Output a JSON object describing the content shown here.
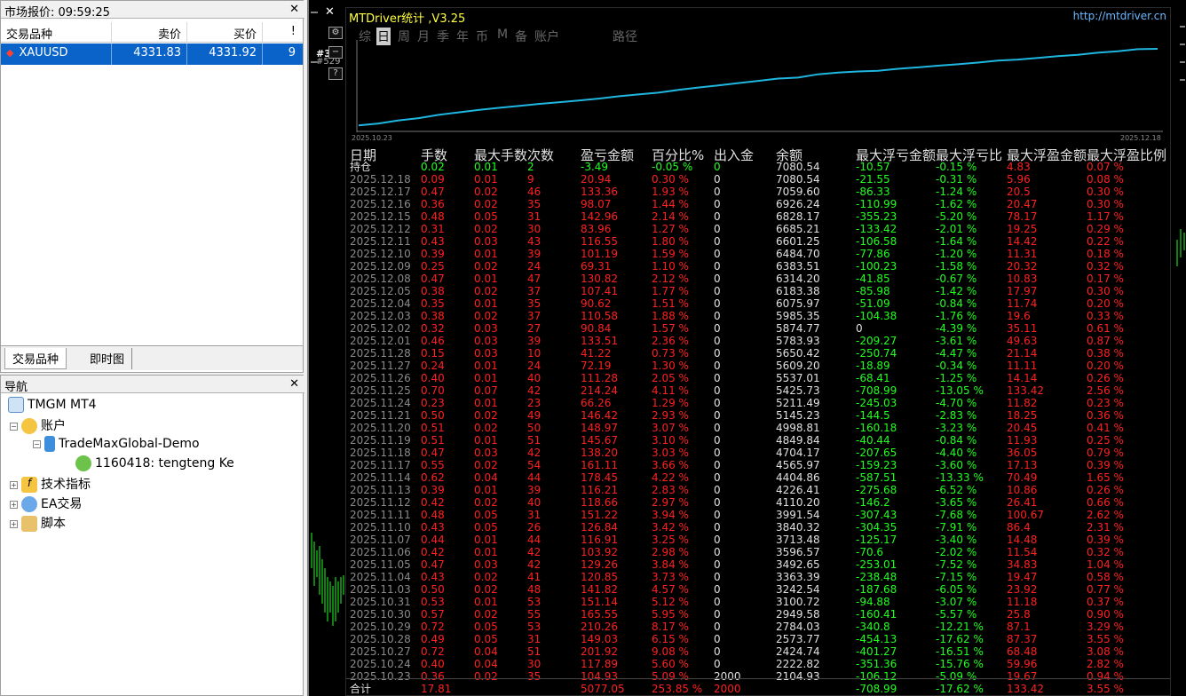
{
  "market_watch": {
    "title": "市场报价: 09:59:25",
    "columns": [
      "交易品种",
      "卖价",
      "买价",
      "!"
    ],
    "row": {
      "symbol": "XAUUSD",
      "bid": "4331.83",
      "ask": "4331.92",
      "spread": "9"
    },
    "tabs": [
      "交易品种",
      "即时图"
    ]
  },
  "navigator": {
    "title": "导航",
    "items": {
      "root": "TMGM MT4",
      "accounts": "账户",
      "account_server": "TradeMaxGlobal-Demo",
      "account_user": "1160418: tengteng Ke",
      "indicators": "技术指标",
      "experts": "EA交易",
      "scripts": "脚本"
    }
  },
  "chart": {
    "label_left": "#3",
    "label_left2": "#529"
  },
  "mtdriver": {
    "title": "MTDriver统计 ,V3.25",
    "url": "http://mtdriver.cn",
    "menu": [
      "综",
      "日",
      "周",
      "月",
      "季",
      "年",
      "币",
      "M",
      "备",
      "账户",
      "路径"
    ],
    "date_start": "2025.10.23",
    "date_end": "2025.12.18",
    "columns": [
      "日期",
      "手数",
      "最大手数",
      "次数",
      "盈亏金额",
      "百分比%",
      "出入金",
      "余额",
      "最大浮亏金额",
      "最大浮亏比",
      "最大浮盈金额",
      "最大浮盈比例"
    ],
    "rows": [
      [
        "持仓",
        "0.02",
        "0.01",
        "2",
        "-3.49",
        "-0.05 %",
        "0",
        "7080.54",
        "-10.57",
        "-0.15 %",
        "4.83",
        "0.07 %"
      ],
      [
        "2025.12.18",
        "0.09",
        "0.01",
        "9",
        "20.94",
        "0.30 %",
        "0",
        "7080.54",
        "-21.55",
        "-0.31 %",
        "5.96",
        "0.08 %"
      ],
      [
        "2025.12.17",
        "0.47",
        "0.02",
        "46",
        "133.36",
        "1.93 %",
        "0",
        "7059.60",
        "-86.33",
        "-1.24 %",
        "20.5",
        "0.30 %"
      ],
      [
        "2025.12.16",
        "0.36",
        "0.02",
        "35",
        "98.07",
        "1.44 %",
        "0",
        "6926.24",
        "-110.99",
        "-1.62 %",
        "20.47",
        "0.30 %"
      ],
      [
        "2025.12.15",
        "0.48",
        "0.05",
        "31",
        "142.96",
        "2.14 %",
        "0",
        "6828.17",
        "-355.23",
        "-5.20 %",
        "78.17",
        "1.17 %"
      ],
      [
        "2025.12.12",
        "0.31",
        "0.02",
        "30",
        "83.96",
        "1.27 %",
        "0",
        "6685.21",
        "-133.42",
        "-2.01 %",
        "19.25",
        "0.29 %"
      ],
      [
        "2025.12.11",
        "0.43",
        "0.03",
        "43",
        "116.55",
        "1.80 %",
        "0",
        "6601.25",
        "-106.58",
        "-1.64 %",
        "14.42",
        "0.22 %"
      ],
      [
        "2025.12.10",
        "0.39",
        "0.01",
        "39",
        "101.19",
        "1.59 %",
        "0",
        "6484.70",
        "-77.86",
        "-1.20 %",
        "11.31",
        "0.18 %"
      ],
      [
        "2025.12.09",
        "0.25",
        "0.02",
        "24",
        "69.31",
        "1.10 %",
        "0",
        "6383.51",
        "-100.23",
        "-1.58 %",
        "20.32",
        "0.32 %"
      ],
      [
        "2025.12.08",
        "0.47",
        "0.01",
        "47",
        "130.82",
        "2.12 %",
        "0",
        "6314.20",
        "-41.85",
        "-0.67 %",
        "10.83",
        "0.17 %"
      ],
      [
        "2025.12.05",
        "0.38",
        "0.02",
        "37",
        "107.41",
        "1.77 %",
        "0",
        "6183.38",
        "-85.98",
        "-1.42 %",
        "17.97",
        "0.30 %"
      ],
      [
        "2025.12.04",
        "0.35",
        "0.01",
        "35",
        "90.62",
        "1.51 %",
        "0",
        "6075.97",
        "-51.09",
        "-0.84 %",
        "11.74",
        "0.20 %"
      ],
      [
        "2025.12.03",
        "0.38",
        "0.02",
        "37",
        "110.58",
        "1.88 %",
        "0",
        "5985.35",
        "-104.38",
        "-1.76 %",
        "19.6",
        "0.33 %"
      ],
      [
        "2025.12.02",
        "0.32",
        "0.03",
        "27",
        "90.84",
        "1.57 %",
        "0",
        "5874.77",
        "0",
        "-4.39 %",
        "35.11",
        "0.61 %"
      ],
      [
        "2025.12.01",
        "0.46",
        "0.03",
        "39",
        "133.51",
        "2.36 %",
        "0",
        "5783.93",
        "-209.27",
        "-3.61 %",
        "49.63",
        "0.87 %"
      ],
      [
        "2025.11.28",
        "0.15",
        "0.03",
        "10",
        "41.22",
        "0.73 %",
        "0",
        "5650.42",
        "-250.74",
        "-4.47 %",
        "21.14",
        "0.38 %"
      ],
      [
        "2025.11.27",
        "0.24",
        "0.01",
        "24",
        "72.19",
        "1.30 %",
        "0",
        "5609.20",
        "-18.89",
        "-0.34 %",
        "11.11",
        "0.20 %"
      ],
      [
        "2025.11.26",
        "0.40",
        "0.01",
        "40",
        "111.28",
        "2.05 %",
        "0",
        "5537.01",
        "-68.41",
        "-1.25 %",
        "14.14",
        "0.26 %"
      ],
      [
        "2025.11.25",
        "0.70",
        "0.07",
        "42",
        "214.24",
        "4.11 %",
        "0",
        "5425.73",
        "-708.99",
        "-13.05 %",
        "133.42",
        "2.56 %"
      ],
      [
        "2025.11.24",
        "0.23",
        "0.01",
        "23",
        "66.26",
        "1.29 %",
        "0",
        "5211.49",
        "-245.03",
        "-4.70 %",
        "11.82",
        "0.23 %"
      ],
      [
        "2025.11.21",
        "0.50",
        "0.02",
        "49",
        "146.42",
        "2.93 %",
        "0",
        "5145.23",
        "-144.5",
        "-2.83 %",
        "18.25",
        "0.36 %"
      ],
      [
        "2025.11.20",
        "0.51",
        "0.02",
        "50",
        "148.97",
        "3.07 %",
        "0",
        "4998.81",
        "-160.18",
        "-3.23 %",
        "20.45",
        "0.41 %"
      ],
      [
        "2025.11.19",
        "0.51",
        "0.01",
        "51",
        "145.67",
        "3.10 %",
        "0",
        "4849.84",
        "-40.44",
        "-0.84 %",
        "11.93",
        "0.25 %"
      ],
      [
        "2025.11.18",
        "0.47",
        "0.03",
        "42",
        "138.20",
        "3.03 %",
        "0",
        "4704.17",
        "-207.65",
        "-4.40 %",
        "36.05",
        "0.79 %"
      ],
      [
        "2025.11.17",
        "0.55",
        "0.02",
        "54",
        "161.11",
        "3.66 %",
        "0",
        "4565.97",
        "-159.23",
        "-3.60 %",
        "17.13",
        "0.39 %"
      ],
      [
        "2025.11.14",
        "0.62",
        "0.04",
        "44",
        "178.45",
        "4.22 %",
        "0",
        "4404.86",
        "-587.51",
        "-13.33 %",
        "70.49",
        "1.65 %"
      ],
      [
        "2025.11.13",
        "0.39",
        "0.01",
        "39",
        "116.21",
        "2.83 %",
        "0",
        "4226.41",
        "-275.68",
        "-6.52 %",
        "10.86",
        "0.26 %"
      ],
      [
        "2025.11.12",
        "0.42",
        "0.02",
        "40",
        "118.66",
        "2.97 %",
        "0",
        "4110.20",
        "-146.2",
        "-3.65 %",
        "26.41",
        "0.66 %"
      ],
      [
        "2025.11.11",
        "0.48",
        "0.05",
        "31",
        "151.22",
        "3.94 %",
        "0",
        "3991.54",
        "-307.43",
        "-7.68 %",
        "100.67",
        "2.62 %"
      ],
      [
        "2025.11.10",
        "0.43",
        "0.05",
        "26",
        "126.84",
        "3.42 %",
        "0",
        "3840.32",
        "-304.35",
        "-7.91 %",
        "86.4",
        "2.31 %"
      ],
      [
        "2025.11.07",
        "0.44",
        "0.01",
        "44",
        "116.91",
        "3.25 %",
        "0",
        "3713.48",
        "-125.17",
        "-3.40 %",
        "14.48",
        "0.39 %"
      ],
      [
        "2025.11.06",
        "0.42",
        "0.01",
        "42",
        "103.92",
        "2.98 %",
        "0",
        "3596.57",
        "-70.6",
        "-2.02 %",
        "11.54",
        "0.32 %"
      ],
      [
        "2025.11.05",
        "0.47",
        "0.03",
        "42",
        "129.26",
        "3.84 %",
        "0",
        "3492.65",
        "-253.01",
        "-7.52 %",
        "34.83",
        "1.04 %"
      ],
      [
        "2025.11.04",
        "0.43",
        "0.02",
        "41",
        "120.85",
        "3.73 %",
        "0",
        "3363.39",
        "-238.48",
        "-7.15 %",
        "19.47",
        "0.58 %"
      ],
      [
        "2025.11.03",
        "0.50",
        "0.02",
        "48",
        "141.82",
        "4.57 %",
        "0",
        "3242.54",
        "-187.68",
        "-6.05 %",
        "23.92",
        "0.77 %"
      ],
      [
        "2025.10.31",
        "0.53",
        "0.01",
        "53",
        "151.14",
        "5.12 %",
        "0",
        "3100.72",
        "-94.88",
        "-3.07 %",
        "11.18",
        "0.37 %"
      ],
      [
        "2025.10.30",
        "0.57",
        "0.02",
        "55",
        "165.55",
        "5.95 %",
        "0",
        "2949.58",
        "-160.41",
        "-5.57 %",
        "25.8",
        "0.90 %"
      ],
      [
        "2025.10.29",
        "0.72",
        "0.05",
        "53",
        "210.26",
        "8.17 %",
        "0",
        "2784.03",
        "-340.8",
        "-12.21 %",
        "87.1",
        "3.29 %"
      ],
      [
        "2025.10.28",
        "0.49",
        "0.05",
        "31",
        "149.03",
        "6.15 %",
        "0",
        "2573.77",
        "-454.13",
        "-17.62 %",
        "87.37",
        "3.55 %"
      ],
      [
        "2025.10.27",
        "0.72",
        "0.04",
        "51",
        "201.92",
        "9.08 %",
        "0",
        "2424.74",
        "-401.27",
        "-16.51 %",
        "68.48",
        "3.08 %"
      ],
      [
        "2025.10.24",
        "0.40",
        "0.04",
        "30",
        "117.89",
        "5.60 %",
        "0",
        "2222.82",
        "-351.36",
        "-15.76 %",
        "59.96",
        "2.82 %"
      ],
      [
        "2025.10.23",
        "0.36",
        "0.02",
        "35",
        "104.93",
        "5.09 %",
        "2000",
        "2104.93",
        "-106.12",
        "-5.09 %",
        "19.67",
        "0.94 %"
      ]
    ],
    "total": [
      "合计",
      "17.81",
      "",
      "",
      "5077.05",
      "253.85 %",
      "2000",
      "",
      "-708.99",
      "-17.62 %",
      "133.42",
      "3.55 %"
    ]
  },
  "colors": {
    "accent": "#1fb6e0",
    "positive": "#ff2020",
    "negative": "#20ff20",
    "title": "#ffff40"
  }
}
